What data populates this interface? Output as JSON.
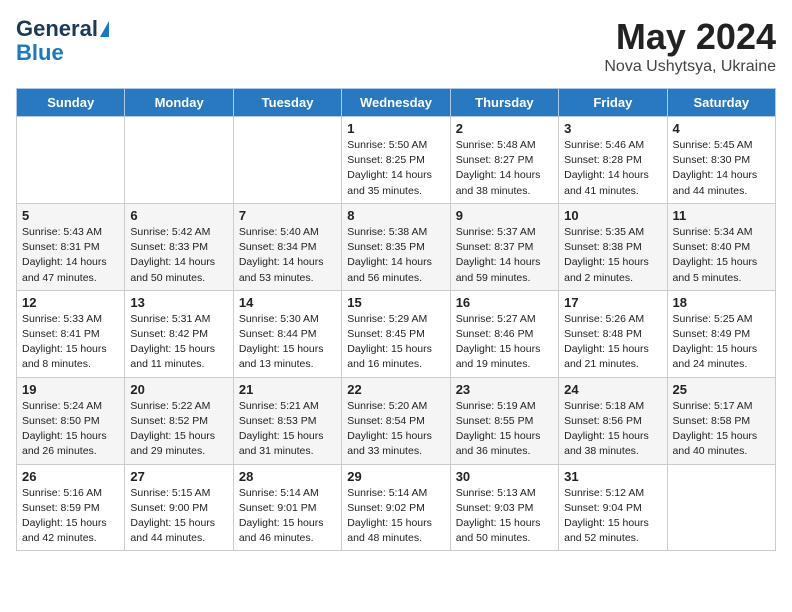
{
  "logo": {
    "line1": "General",
    "line2": "Blue"
  },
  "title": "May 2024",
  "subtitle": "Nova Ushytsya, Ukraine",
  "days_of_week": [
    "Sunday",
    "Monday",
    "Tuesday",
    "Wednesday",
    "Thursday",
    "Friday",
    "Saturday"
  ],
  "weeks": [
    [
      {
        "day": "",
        "info": ""
      },
      {
        "day": "",
        "info": ""
      },
      {
        "day": "",
        "info": ""
      },
      {
        "day": "1",
        "info": "Sunrise: 5:50 AM\nSunset: 8:25 PM\nDaylight: 14 hours\nand 35 minutes."
      },
      {
        "day": "2",
        "info": "Sunrise: 5:48 AM\nSunset: 8:27 PM\nDaylight: 14 hours\nand 38 minutes."
      },
      {
        "day": "3",
        "info": "Sunrise: 5:46 AM\nSunset: 8:28 PM\nDaylight: 14 hours\nand 41 minutes."
      },
      {
        "day": "4",
        "info": "Sunrise: 5:45 AM\nSunset: 8:30 PM\nDaylight: 14 hours\nand 44 minutes."
      }
    ],
    [
      {
        "day": "5",
        "info": "Sunrise: 5:43 AM\nSunset: 8:31 PM\nDaylight: 14 hours\nand 47 minutes."
      },
      {
        "day": "6",
        "info": "Sunrise: 5:42 AM\nSunset: 8:33 PM\nDaylight: 14 hours\nand 50 minutes."
      },
      {
        "day": "7",
        "info": "Sunrise: 5:40 AM\nSunset: 8:34 PM\nDaylight: 14 hours\nand 53 minutes."
      },
      {
        "day": "8",
        "info": "Sunrise: 5:38 AM\nSunset: 8:35 PM\nDaylight: 14 hours\nand 56 minutes."
      },
      {
        "day": "9",
        "info": "Sunrise: 5:37 AM\nSunset: 8:37 PM\nDaylight: 14 hours\nand 59 minutes."
      },
      {
        "day": "10",
        "info": "Sunrise: 5:35 AM\nSunset: 8:38 PM\nDaylight: 15 hours\nand 2 minutes."
      },
      {
        "day": "11",
        "info": "Sunrise: 5:34 AM\nSunset: 8:40 PM\nDaylight: 15 hours\nand 5 minutes."
      }
    ],
    [
      {
        "day": "12",
        "info": "Sunrise: 5:33 AM\nSunset: 8:41 PM\nDaylight: 15 hours\nand 8 minutes."
      },
      {
        "day": "13",
        "info": "Sunrise: 5:31 AM\nSunset: 8:42 PM\nDaylight: 15 hours\nand 11 minutes."
      },
      {
        "day": "14",
        "info": "Sunrise: 5:30 AM\nSunset: 8:44 PM\nDaylight: 15 hours\nand 13 minutes."
      },
      {
        "day": "15",
        "info": "Sunrise: 5:29 AM\nSunset: 8:45 PM\nDaylight: 15 hours\nand 16 minutes."
      },
      {
        "day": "16",
        "info": "Sunrise: 5:27 AM\nSunset: 8:46 PM\nDaylight: 15 hours\nand 19 minutes."
      },
      {
        "day": "17",
        "info": "Sunrise: 5:26 AM\nSunset: 8:48 PM\nDaylight: 15 hours\nand 21 minutes."
      },
      {
        "day": "18",
        "info": "Sunrise: 5:25 AM\nSunset: 8:49 PM\nDaylight: 15 hours\nand 24 minutes."
      }
    ],
    [
      {
        "day": "19",
        "info": "Sunrise: 5:24 AM\nSunset: 8:50 PM\nDaylight: 15 hours\nand 26 minutes."
      },
      {
        "day": "20",
        "info": "Sunrise: 5:22 AM\nSunset: 8:52 PM\nDaylight: 15 hours\nand 29 minutes."
      },
      {
        "day": "21",
        "info": "Sunrise: 5:21 AM\nSunset: 8:53 PM\nDaylight: 15 hours\nand 31 minutes."
      },
      {
        "day": "22",
        "info": "Sunrise: 5:20 AM\nSunset: 8:54 PM\nDaylight: 15 hours\nand 33 minutes."
      },
      {
        "day": "23",
        "info": "Sunrise: 5:19 AM\nSunset: 8:55 PM\nDaylight: 15 hours\nand 36 minutes."
      },
      {
        "day": "24",
        "info": "Sunrise: 5:18 AM\nSunset: 8:56 PM\nDaylight: 15 hours\nand 38 minutes."
      },
      {
        "day": "25",
        "info": "Sunrise: 5:17 AM\nSunset: 8:58 PM\nDaylight: 15 hours\nand 40 minutes."
      }
    ],
    [
      {
        "day": "26",
        "info": "Sunrise: 5:16 AM\nSunset: 8:59 PM\nDaylight: 15 hours\nand 42 minutes."
      },
      {
        "day": "27",
        "info": "Sunrise: 5:15 AM\nSunset: 9:00 PM\nDaylight: 15 hours\nand 44 minutes."
      },
      {
        "day": "28",
        "info": "Sunrise: 5:14 AM\nSunset: 9:01 PM\nDaylight: 15 hours\nand 46 minutes."
      },
      {
        "day": "29",
        "info": "Sunrise: 5:14 AM\nSunset: 9:02 PM\nDaylight: 15 hours\nand 48 minutes."
      },
      {
        "day": "30",
        "info": "Sunrise: 5:13 AM\nSunset: 9:03 PM\nDaylight: 15 hours\nand 50 minutes."
      },
      {
        "day": "31",
        "info": "Sunrise: 5:12 AM\nSunset: 9:04 PM\nDaylight: 15 hours\nand 52 minutes."
      },
      {
        "day": "",
        "info": ""
      }
    ]
  ]
}
